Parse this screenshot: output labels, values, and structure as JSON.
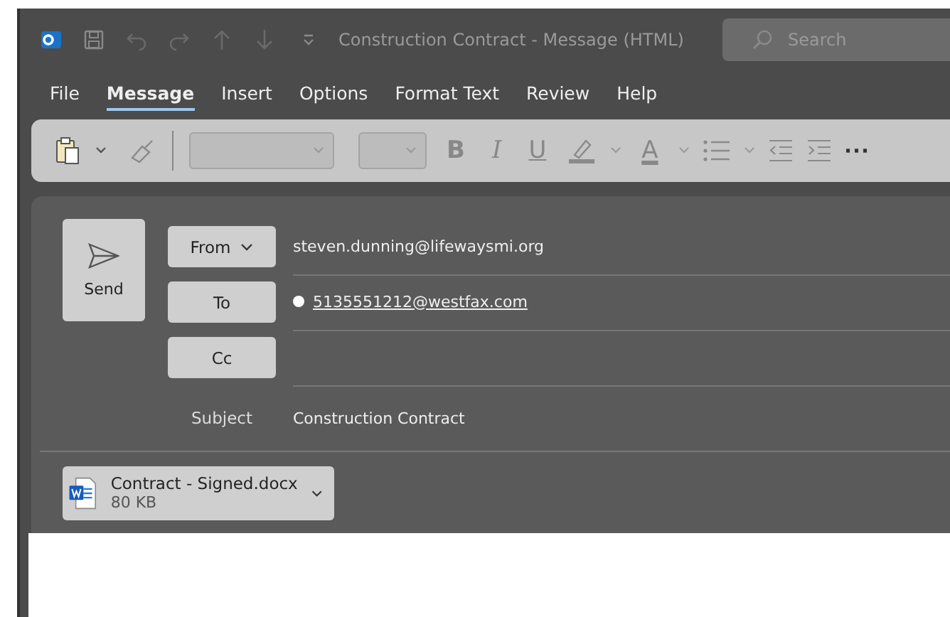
{
  "window": {
    "title": "Construction Contract  -  Message (HTML)"
  },
  "search": {
    "placeholder": "Search"
  },
  "tabs": [
    {
      "label": "File",
      "selected": false
    },
    {
      "label": "Message",
      "selected": true
    },
    {
      "label": "Insert",
      "selected": false
    },
    {
      "label": "Options",
      "selected": false
    },
    {
      "label": "Format Text",
      "selected": false
    },
    {
      "label": "Review",
      "selected": false
    },
    {
      "label": "Help",
      "selected": false
    }
  ],
  "format_buttons": [
    {
      "kind": "bold",
      "label": "B"
    },
    {
      "kind": "italic",
      "label": "I"
    },
    {
      "kind": "underline",
      "label": "U"
    }
  ],
  "font_color": {
    "label": "A"
  },
  "more": "···",
  "send": {
    "label": "Send"
  },
  "fields": [
    {
      "kind": "button",
      "label": "From",
      "dropdown": true,
      "value": "steven.dunning@lifewaysmi.org",
      "recipient": false
    },
    {
      "kind": "button",
      "label": "To",
      "dropdown": false,
      "value": "5135551212@westfax.com",
      "recipient": true
    },
    {
      "kind": "button",
      "label": "Cc",
      "dropdown": false
    },
    {
      "kind": "label",
      "label": "Subject",
      "value": "Construction Contract"
    }
  ],
  "attachment": {
    "name": "Contract - Signed.docx",
    "size": "80 KB"
  }
}
